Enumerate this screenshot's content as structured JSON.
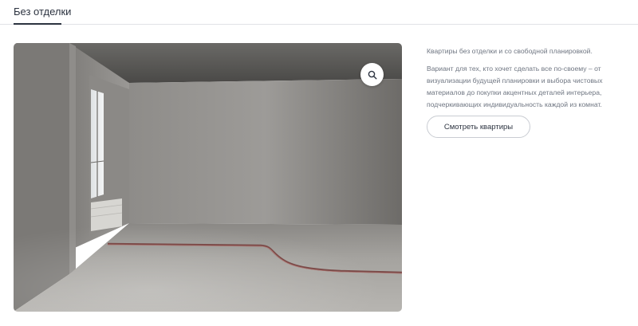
{
  "tabs": {
    "active_label": "Без отделки"
  },
  "info": {
    "lead": "Квартиры без отделки и со свободной планировкой.",
    "description": "Вариант для тех, кто хочет сделать все по-своему – от визуализации будущей планировки и выбора чистовых материалов до покупки акцентных деталей интерьера, подчеркивающих индивидуальность каждой из комнат."
  },
  "cta": {
    "label": "Смотреть квартиры"
  },
  "icons": {
    "zoom": "magnifier-icon"
  },
  "colors": {
    "text": "#2c3340",
    "muted_text": "#6f7682",
    "divider": "#e1e3e7",
    "button_border": "#c9ccd2"
  }
}
